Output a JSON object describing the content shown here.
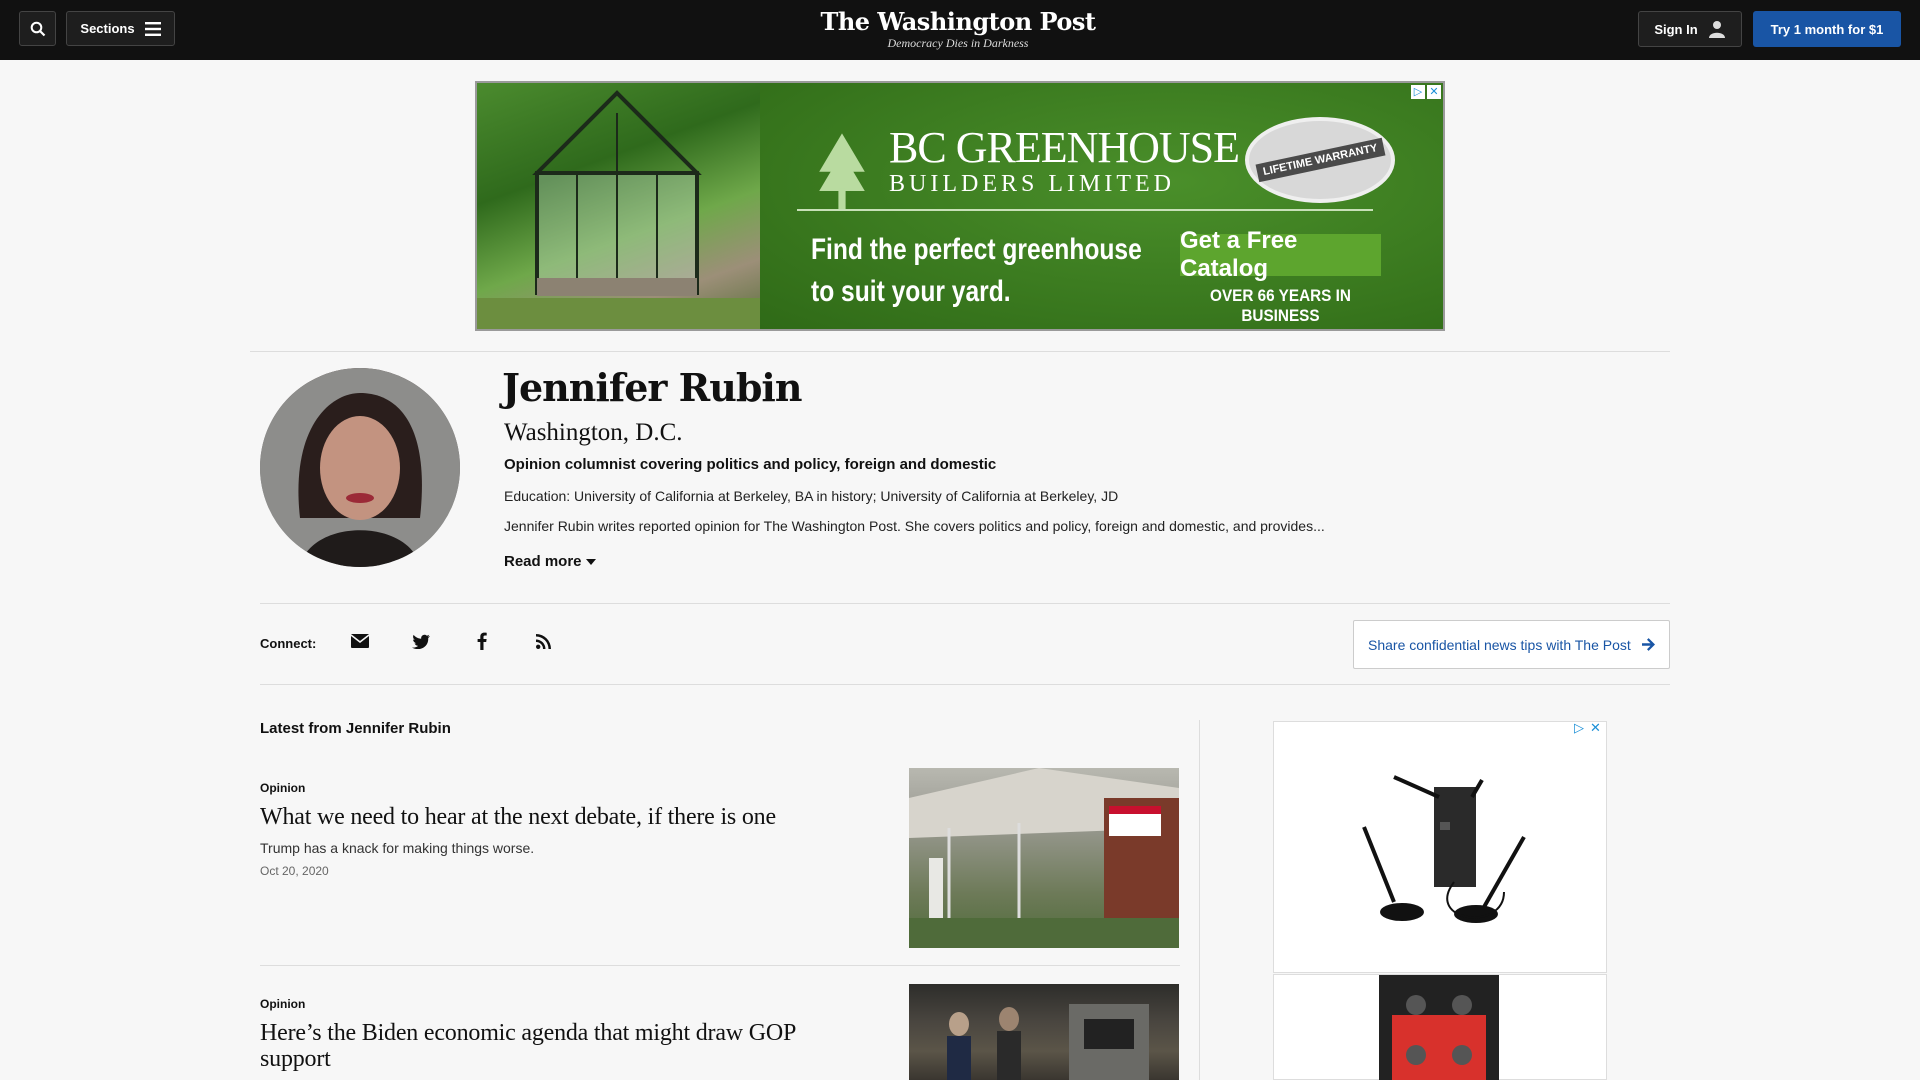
{
  "header": {
    "sections_label": "Sections",
    "logo_title": "The Washington Post",
    "logo_tagline": "Democracy Dies in Darkness",
    "signin_label": "Sign In",
    "trial_label": "Try 1 month for $1"
  },
  "top_ad": {
    "brand_line1": "BC GREENHOUSE",
    "brand_line2": "BUILDERS LIMITED",
    "seal_text": "LIFETIME WARRANTY",
    "headline_line1": "Find the perfect greenhouse",
    "headline_line2": "to suit your yard.",
    "cta": "Get a Free Catalog",
    "years": "OVER 66 YEARS IN BUSINESS",
    "brand_color": "#3e7d20"
  },
  "author": {
    "name": "Jennifer Rubin",
    "location": "Washington, D.C.",
    "tagline": "Opinion columnist covering politics and policy, foreign and domestic",
    "education": "Education: University of California at Berkeley, BA in history; University of California at Berkeley, JD",
    "bio": "Jennifer Rubin writes reported opinion for The Washington Post. She covers politics and policy, foreign and domestic, and provides...",
    "read_more": "Read more"
  },
  "connect": {
    "label": "Connect:",
    "icons": [
      "email-icon",
      "twitter-icon",
      "facebook-icon",
      "rss-icon"
    ],
    "tips_label": "Share confidential news tips with The Post"
  },
  "latest": {
    "heading": "Latest from Jennifer Rubin",
    "articles": [
      {
        "kicker": "Opinion",
        "title": "What we need to hear at the next debate, if there is one",
        "blurb": "Trump has a knack for making things worse.",
        "date": "Oct 20, 2020"
      },
      {
        "kicker": "Opinion",
        "title": "Here’s the Biden economic agenda that might draw GOP support",
        "blurb": "",
        "date": ""
      }
    ]
  },
  "colors": {
    "header_bg": "#111111",
    "accent_blue": "#1955a5"
  }
}
